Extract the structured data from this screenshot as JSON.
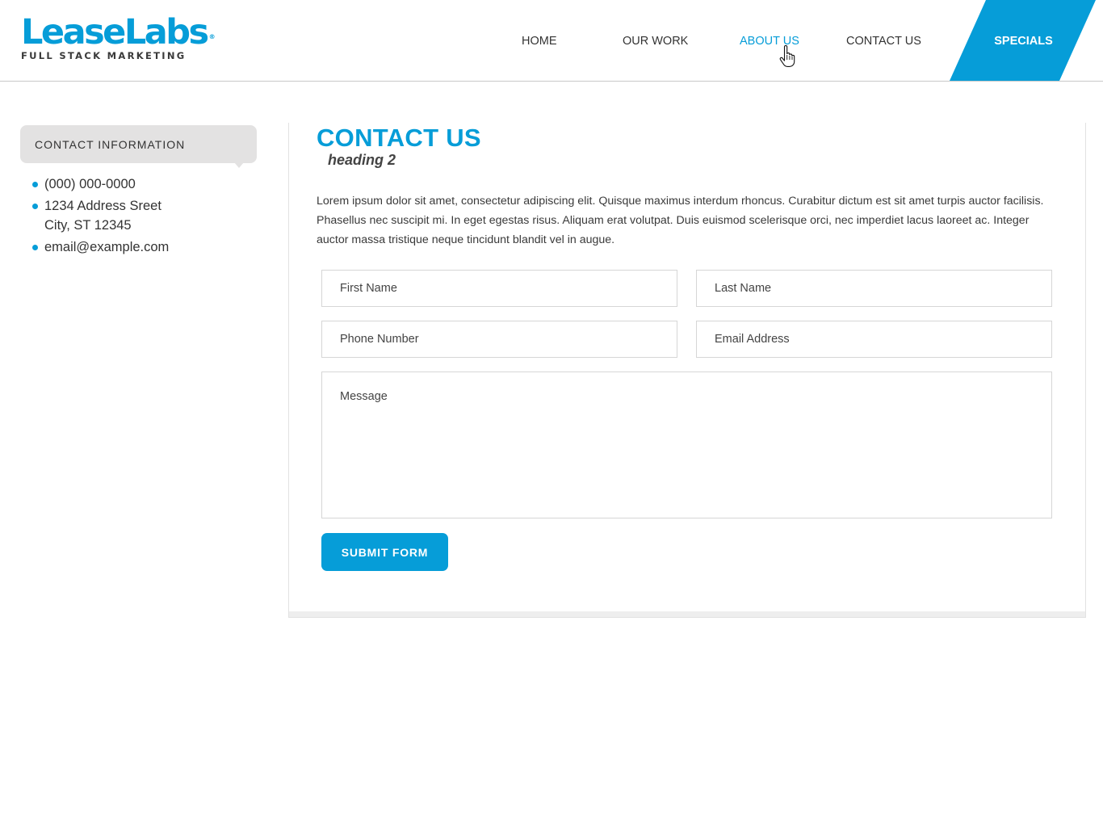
{
  "brand": {
    "name": "LeaseLabs",
    "registered_mark": "®",
    "tagline": "FULL STACK MARKETING",
    "accent_color": "#069dd8"
  },
  "nav": {
    "items": [
      {
        "label": "HOME"
      },
      {
        "label": "OUR WORK"
      },
      {
        "label": "ABOUT US",
        "state": "hover"
      },
      {
        "label": "CONTACT US"
      }
    ],
    "specials_label": "SPECIALS",
    "cursor_icon": "pointer-hand-icon"
  },
  "sidebar": {
    "heading": "CONTACT INFORMATION",
    "phone": "(000) 000-0000",
    "address_line1": "1234 Address Sreet",
    "address_line2": "City, ST 12345",
    "email": "email@example.com"
  },
  "main": {
    "title": "CONTACT US",
    "subtitle": "heading 2",
    "intro": "Lorem ipsum dolor sit amet, consectetur adipiscing elit. Quisque maximus interdum rhoncus. Curabitur dictum est sit amet turpis auctor facilisis. Phasellus nec suscipit mi. In eget egestas risus. Aliquam erat volutpat. Duis euismod scelerisque orci, nec imperdiet lacus laoreet ac. Integer auctor massa tristique neque tincidunt blandit vel in augue."
  },
  "form": {
    "first_name_placeholder": "First Name",
    "last_name_placeholder": "Last Name",
    "phone_placeholder": "Phone Number",
    "email_placeholder": "Email Address",
    "message_placeholder": "Message",
    "submit_label": "SUBMIT FORM"
  }
}
